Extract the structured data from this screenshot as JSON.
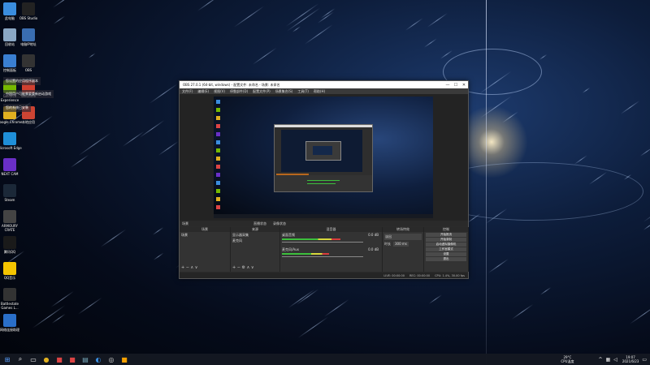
{
  "desktop": {
    "icons": [
      {
        "label": "此电脑",
        "icon": "computer-icon",
        "color": "#3a8dde"
      },
      {
        "label": "回收站",
        "icon": "recycle-bin-icon",
        "color": "#8aa7c4"
      },
      {
        "label": "控制面板",
        "icon": "control-panel-icon",
        "color": "#3a7fd1"
      },
      {
        "label": "GeForce Experience",
        "icon": "geforce-icon",
        "color": "#76b900"
      },
      {
        "label": "Google Chrome",
        "icon": "chrome-icon",
        "color": "#e0b020"
      },
      {
        "label": "Microsoft Edge",
        "icon": "edge-icon",
        "color": "#1f8fd8"
      },
      {
        "label": "NEXT CAM",
        "icon": "nextcam-icon",
        "color": "#6a2fc7"
      },
      {
        "label": "Steam",
        "icon": "steam-icon",
        "color": "#1b2838"
      },
      {
        "label": "ARMOURY CRATE",
        "icon": "armoury-icon",
        "color": "#444"
      },
      {
        "label": "腾讯QQ",
        "icon": "qq-icon",
        "color": "#1a1a1a"
      },
      {
        "label": "QQ音乐",
        "icon": "qqmusic-icon",
        "color": "#f5c400"
      },
      {
        "label": "Battlestate Games L...",
        "icon": "battlestate-icon",
        "color": "#333"
      },
      {
        "label": "网络连接助理",
        "icon": "network-icon",
        "color": "#2a6fc9"
      }
    ],
    "icons_col2": [
      {
        "label": "OBS Studio",
        "icon": "obs-icon",
        "color": "#222"
      },
      {
        "label": "电脑IP地址",
        "icon": "ip-icon",
        "color": "#3a6db0"
      },
      {
        "label": "OBS",
        "icon": "obs-small-icon",
        "color": "#333"
      },
      {
        "label": "WeGame",
        "icon": "wegame-icon",
        "color": "#d04030"
      },
      {
        "label": "本地应用",
        "icon": "local-app-icon",
        "color": "#c43"
      }
    ],
    "notifications": [
      "您设置的应用程序副本",
      "中国用户可能需要重新启动游戏",
      "您的系统已安装"
    ]
  },
  "obs": {
    "title": "OBS 27.0.1 (64-bit, windows) - 配置文件: 未命名 - 场景: 未命名",
    "menu": [
      "文件(F)",
      "编辑(E)",
      "视图(V)",
      "停靠部件(D)",
      "配置文件(P)",
      "场景集合(S)",
      "工具(T)",
      "帮助(H)"
    ],
    "status_bar": [
      "直播状态",
      "录像状态"
    ],
    "panels": {
      "scenes": {
        "title": "场景",
        "items": [
          "场景"
        ]
      },
      "sources": {
        "title": "来源",
        "items": [
          "显示器采集",
          "麦克风"
        ]
      },
      "mixer": {
        "title": "混音器",
        "tracks": [
          {
            "name": "桌面音频",
            "db": "0.0 dB",
            "level": 0.72
          },
          {
            "name": "麦克风/Aux",
            "db": "0.0 dB",
            "level": 0.58
          }
        ]
      },
      "transitions": {
        "title": "转场特效",
        "type": "淡出",
        "duration_label": "时长",
        "duration": "300 ms"
      },
      "controls": {
        "title": "控制",
        "buttons": [
          "开始推流",
          "开始录制",
          "启动虚拟摄像机",
          "工作室模式",
          "设置",
          "退出"
        ]
      }
    },
    "footer": {
      "live": "LIVE: 00:00:00",
      "rec": "REC: 00:00:00",
      "cpu": "CPU: 1.4%, 30.00 fps"
    }
  },
  "taskbar": {
    "apps": [
      "start-icon",
      "search-icon",
      "taskview-icon",
      "chrome-icon",
      "obs-icon",
      "folder-icon",
      "edge-icon",
      "steam-icon",
      "qq-icon"
    ],
    "weather": "29°C",
    "weather_sub": "CPU温度",
    "time": "19:07",
    "date": "2021/6/23"
  }
}
